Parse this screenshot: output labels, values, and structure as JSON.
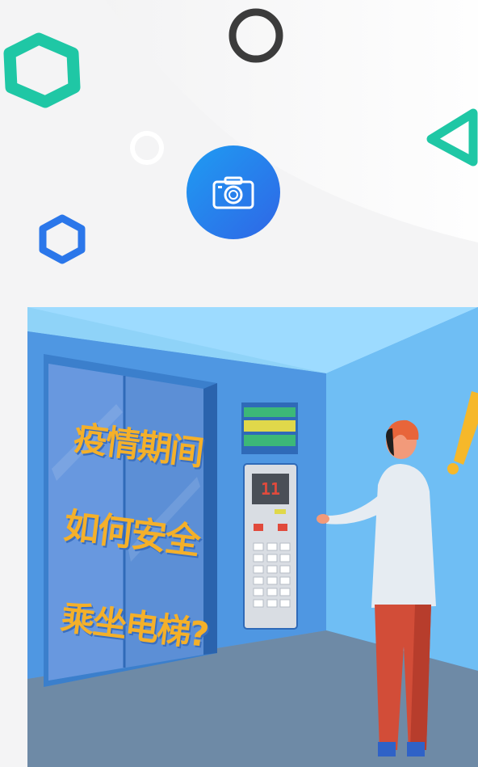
{
  "camera_button": {
    "icon": "camera-icon"
  },
  "illustration": {
    "line1": "疫情期间",
    "line2": "如何安全",
    "line3": "乘坐电梯?",
    "display_digits": "11"
  },
  "colors": {
    "teal_shape": "#1fc7a5",
    "blue_shape": "#2b77ea",
    "ring_dark": "#3c3c3c",
    "camera_gradient_start": "#1f9cf2",
    "camera_gradient_end": "#2f66e6",
    "text_yellow": "#f4b02a"
  }
}
